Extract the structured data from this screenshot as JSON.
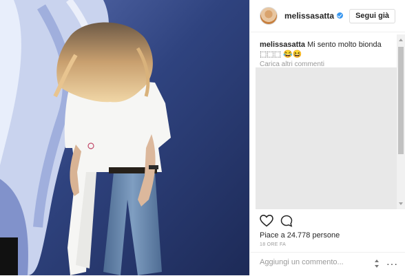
{
  "post": {
    "username": "melissasatta",
    "follow_label": "Segui già",
    "caption_text": "Mi sento molto bionda ⬚⬚⬚ 😂😆",
    "load_more": "Carica altri commenti",
    "comments_faint_text": "",
    "likes_text": "Piace a 24.778 persone",
    "time_text": "18 ORE FA",
    "comment_placeholder": "Aggiungi un commento...",
    "more_options": "···"
  },
  "colors": {
    "wall": "#2b3e7a",
    "accent_verified": "#3897f0"
  },
  "icons": [
    "verified-badge-icon",
    "heart-icon",
    "comment-icon",
    "scroll-arrow-icon",
    "more-options-icon"
  ]
}
